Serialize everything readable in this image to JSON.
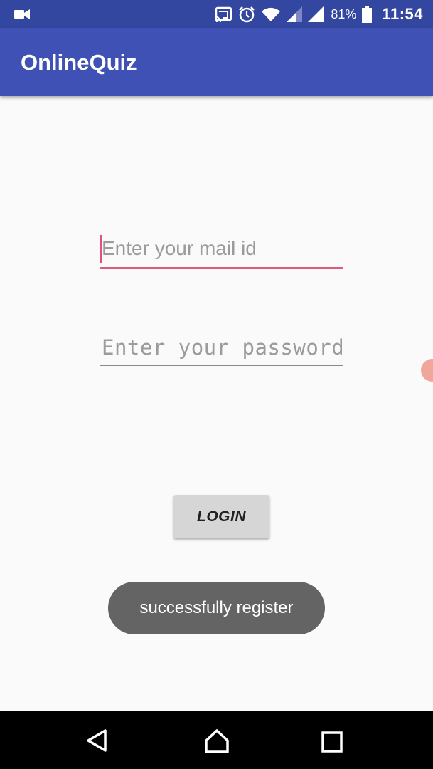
{
  "status_bar": {
    "battery_percent": "81%",
    "time": "11:54",
    "icons": [
      "video-camera-icon",
      "cast-icon",
      "alarm-icon",
      "wifi-icon",
      "signal-icon",
      "signal-icon",
      "battery-icon"
    ]
  },
  "app_bar": {
    "title": "OnlineQuiz",
    "color": "#3f51b5"
  },
  "login_form": {
    "email_placeholder": "Enter your mail id",
    "password_placeholder": "Enter your password",
    "login_label": "LOGIN"
  },
  "toast": {
    "message": "successfully register"
  },
  "nav_bar": {
    "icons": [
      "back-icon",
      "home-icon",
      "recents-icon"
    ]
  }
}
